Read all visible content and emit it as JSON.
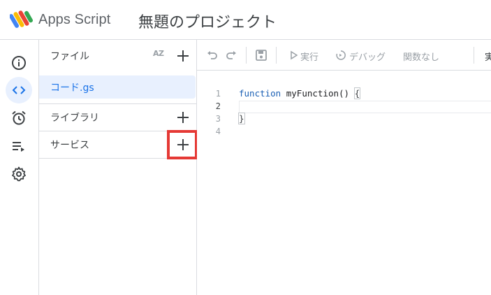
{
  "header": {
    "app_name": "Apps Script",
    "project_title": "無題のプロジェクト"
  },
  "rail": {
    "items": [
      {
        "icon": "info-icon",
        "label": "概要"
      },
      {
        "icon": "code-icon",
        "label": "エディタ",
        "active": true
      },
      {
        "icon": "alarm-icon",
        "label": "トリガー"
      },
      {
        "icon": "executions-icon",
        "label": "実行数"
      },
      {
        "icon": "gear-icon",
        "label": "プロジェクトの設定"
      }
    ]
  },
  "files_panel": {
    "files_label": "ファイル",
    "sort_label": "AZ",
    "files": [
      {
        "name": "コード.gs",
        "selected": true
      }
    ],
    "libraries_label": "ライブラリ",
    "services_label": "サービス"
  },
  "toolbar": {
    "run_label": "実行",
    "debug_label": "デバッグ",
    "function_select": "関数なし",
    "log_label_partial": "実"
  },
  "editor": {
    "lines": [
      {
        "num": "1",
        "keyword": "function",
        "rest": " myFunction() ",
        "brace": "{"
      },
      {
        "num": "2",
        "keyword": "",
        "rest": "",
        "brace": ""
      },
      {
        "num": "3",
        "keyword": "",
        "rest": "",
        "brace": "}"
      },
      {
        "num": "4",
        "keyword": "",
        "rest": "",
        "brace": ""
      }
    ]
  },
  "colors": {
    "accent": "#1a73e8",
    "active_bg": "#e8f0fe",
    "highlight": "#e53935",
    "divider": "#dadce0"
  }
}
